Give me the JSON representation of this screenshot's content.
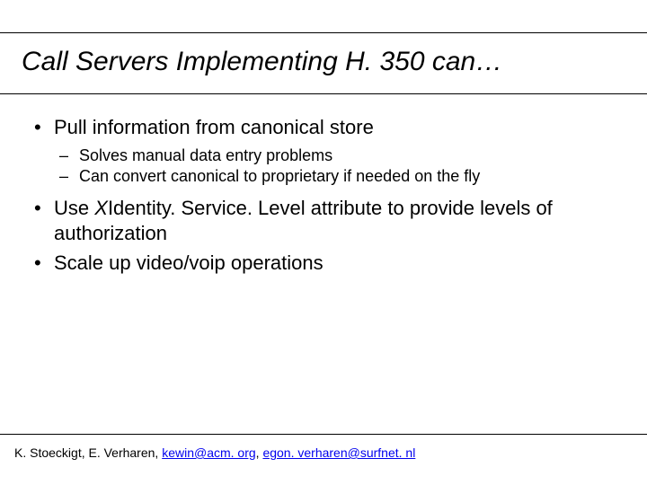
{
  "title": "Call Servers Implementing H. 350 can…",
  "bullets": {
    "b1": "Pull information from canonical store",
    "b1_sub1": "Solves manual data entry problems",
    "b1_sub2": "Can convert canonical to proprietary if needed on the fly",
    "b2_pre": "Use ",
    "b2_x": "X",
    "b2_post": "Identity. Service. Level attribute to provide levels of authorization",
    "b3": "Scale up video/voip operations"
  },
  "footer": {
    "authors": "K. Stoeckigt, E. Verharen, ",
    "email1": "kewin@acm. org",
    "sep": ", ",
    "email2": "egon. verharen@surfnet. nl"
  }
}
